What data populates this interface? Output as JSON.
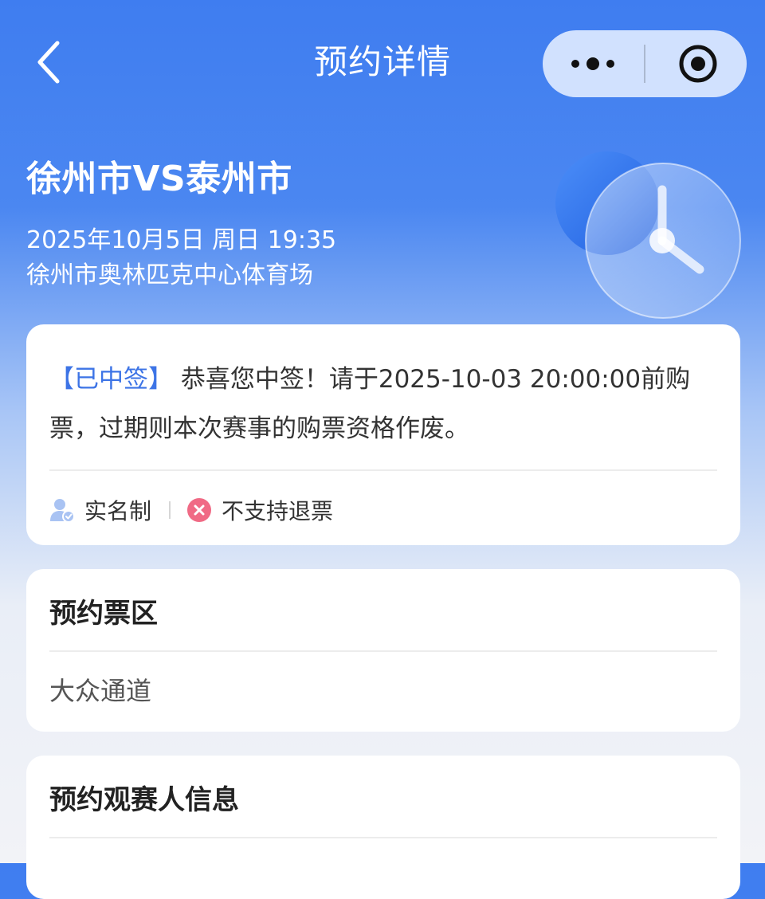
{
  "nav": {
    "title": "预约详情",
    "back_icon": "chevron-left-icon",
    "more_icon": "more-dots-icon",
    "close_icon": "target-close-icon"
  },
  "match": {
    "title": "徐州市VS泰州市",
    "datetime": "2025年10月5日 周日 19:35",
    "venue": "徐州市奥林匹克中心体育场",
    "decoration_icon": "clock-icon"
  },
  "notice": {
    "tag": "【已中签】",
    "message": "恭喜您中签！请于2025-10-03 20:00:00前购票，过期则本次赛事的购票资格作废。",
    "rules": [
      {
        "label": "实名制",
        "icon": "verified-user-icon"
      },
      {
        "label": "不支持退票",
        "icon": "cross-circle-icon"
      }
    ]
  },
  "zone": {
    "title": "预约票区",
    "value": "大众通道"
  },
  "viewer": {
    "title": "预约观赛人信息"
  },
  "colors": {
    "primary_blue": "#3f7df0",
    "tag_blue": "#3d74e6",
    "no_refund_red": "#f06a85"
  }
}
